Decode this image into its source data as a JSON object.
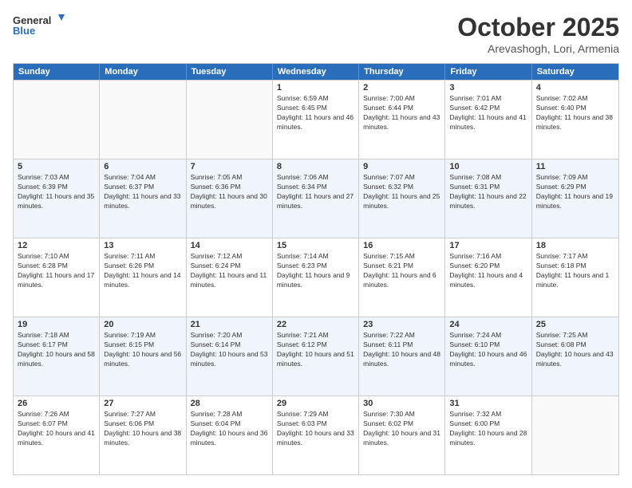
{
  "logo": {
    "text_general": "General",
    "text_blue": "Blue"
  },
  "title": "October 2025",
  "location": "Arevashogh, Lori, Armenia",
  "days_of_week": [
    "Sunday",
    "Monday",
    "Tuesday",
    "Wednesday",
    "Thursday",
    "Friday",
    "Saturday"
  ],
  "weeks": [
    [
      {
        "day": "",
        "text": ""
      },
      {
        "day": "",
        "text": ""
      },
      {
        "day": "",
        "text": ""
      },
      {
        "day": "1",
        "text": "Sunrise: 6:59 AM\nSunset: 6:45 PM\nDaylight: 11 hours and 46 minutes."
      },
      {
        "day": "2",
        "text": "Sunrise: 7:00 AM\nSunset: 6:44 PM\nDaylight: 11 hours and 43 minutes."
      },
      {
        "day": "3",
        "text": "Sunrise: 7:01 AM\nSunset: 6:42 PM\nDaylight: 11 hours and 41 minutes."
      },
      {
        "day": "4",
        "text": "Sunrise: 7:02 AM\nSunset: 6:40 PM\nDaylight: 11 hours and 38 minutes."
      }
    ],
    [
      {
        "day": "5",
        "text": "Sunrise: 7:03 AM\nSunset: 6:39 PM\nDaylight: 11 hours and 35 minutes."
      },
      {
        "day": "6",
        "text": "Sunrise: 7:04 AM\nSunset: 6:37 PM\nDaylight: 11 hours and 33 minutes."
      },
      {
        "day": "7",
        "text": "Sunrise: 7:05 AM\nSunset: 6:36 PM\nDaylight: 11 hours and 30 minutes."
      },
      {
        "day": "8",
        "text": "Sunrise: 7:06 AM\nSunset: 6:34 PM\nDaylight: 11 hours and 27 minutes."
      },
      {
        "day": "9",
        "text": "Sunrise: 7:07 AM\nSunset: 6:32 PM\nDaylight: 11 hours and 25 minutes."
      },
      {
        "day": "10",
        "text": "Sunrise: 7:08 AM\nSunset: 6:31 PM\nDaylight: 11 hours and 22 minutes."
      },
      {
        "day": "11",
        "text": "Sunrise: 7:09 AM\nSunset: 6:29 PM\nDaylight: 11 hours and 19 minutes."
      }
    ],
    [
      {
        "day": "12",
        "text": "Sunrise: 7:10 AM\nSunset: 6:28 PM\nDaylight: 11 hours and 17 minutes."
      },
      {
        "day": "13",
        "text": "Sunrise: 7:11 AM\nSunset: 6:26 PM\nDaylight: 11 hours and 14 minutes."
      },
      {
        "day": "14",
        "text": "Sunrise: 7:12 AM\nSunset: 6:24 PM\nDaylight: 11 hours and 11 minutes."
      },
      {
        "day": "15",
        "text": "Sunrise: 7:14 AM\nSunset: 6:23 PM\nDaylight: 11 hours and 9 minutes."
      },
      {
        "day": "16",
        "text": "Sunrise: 7:15 AM\nSunset: 6:21 PM\nDaylight: 11 hours and 6 minutes."
      },
      {
        "day": "17",
        "text": "Sunrise: 7:16 AM\nSunset: 6:20 PM\nDaylight: 11 hours and 4 minutes."
      },
      {
        "day": "18",
        "text": "Sunrise: 7:17 AM\nSunset: 6:18 PM\nDaylight: 11 hours and 1 minute."
      }
    ],
    [
      {
        "day": "19",
        "text": "Sunrise: 7:18 AM\nSunset: 6:17 PM\nDaylight: 10 hours and 58 minutes."
      },
      {
        "day": "20",
        "text": "Sunrise: 7:19 AM\nSunset: 6:15 PM\nDaylight: 10 hours and 56 minutes."
      },
      {
        "day": "21",
        "text": "Sunrise: 7:20 AM\nSunset: 6:14 PM\nDaylight: 10 hours and 53 minutes."
      },
      {
        "day": "22",
        "text": "Sunrise: 7:21 AM\nSunset: 6:12 PM\nDaylight: 10 hours and 51 minutes."
      },
      {
        "day": "23",
        "text": "Sunrise: 7:22 AM\nSunset: 6:11 PM\nDaylight: 10 hours and 48 minutes."
      },
      {
        "day": "24",
        "text": "Sunrise: 7:24 AM\nSunset: 6:10 PM\nDaylight: 10 hours and 46 minutes."
      },
      {
        "day": "25",
        "text": "Sunrise: 7:25 AM\nSunset: 6:08 PM\nDaylight: 10 hours and 43 minutes."
      }
    ],
    [
      {
        "day": "26",
        "text": "Sunrise: 7:26 AM\nSunset: 6:07 PM\nDaylight: 10 hours and 41 minutes."
      },
      {
        "day": "27",
        "text": "Sunrise: 7:27 AM\nSunset: 6:06 PM\nDaylight: 10 hours and 38 minutes."
      },
      {
        "day": "28",
        "text": "Sunrise: 7:28 AM\nSunset: 6:04 PM\nDaylight: 10 hours and 36 minutes."
      },
      {
        "day": "29",
        "text": "Sunrise: 7:29 AM\nSunset: 6:03 PM\nDaylight: 10 hours and 33 minutes."
      },
      {
        "day": "30",
        "text": "Sunrise: 7:30 AM\nSunset: 6:02 PM\nDaylight: 10 hours and 31 minutes."
      },
      {
        "day": "31",
        "text": "Sunrise: 7:32 AM\nSunset: 6:00 PM\nDaylight: 10 hours and 28 minutes."
      },
      {
        "day": "",
        "text": ""
      }
    ]
  ]
}
